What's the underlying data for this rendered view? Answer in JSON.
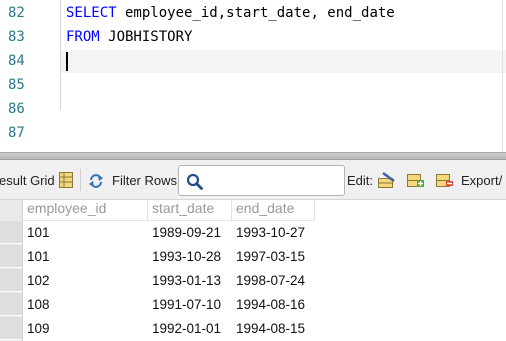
{
  "editor": {
    "line_numbers": [
      "82",
      "83",
      "84",
      "85",
      "86",
      "87"
    ],
    "lines": [
      {
        "keyword": "SELECT",
        "rest": " employee_id,start_date, end_date"
      },
      {
        "keyword": "FROM",
        "rest": " JOBHISTORY"
      }
    ],
    "keyword_color": "#0000ff",
    "line_number_color": "#2b7a8c"
  },
  "toolbar": {
    "result_grid_label": "esult Grid",
    "filter_rows_label": "Filter Rows:",
    "filter_value": "",
    "edit_label": "Edit:",
    "export_label": "Export/",
    "icons": [
      "grid-layout-icon",
      "refresh-icon",
      "search-icon",
      "edit-row-icon",
      "add-row-icon",
      "delete-row-icon",
      "export-icon"
    ]
  },
  "grid": {
    "columns": [
      "employee_id",
      "start_date",
      "end_date"
    ],
    "rows": [
      [
        "101",
        "1989-09-21",
        "1993-10-27"
      ],
      [
        "101",
        "1993-10-28",
        "1997-03-15"
      ],
      [
        "102",
        "1993-01-13",
        "1998-07-24"
      ],
      [
        "108",
        "1991-07-10",
        "1994-08-16"
      ],
      [
        "109",
        "1992-01-01",
        "1994-08-15"
      ]
    ]
  }
}
